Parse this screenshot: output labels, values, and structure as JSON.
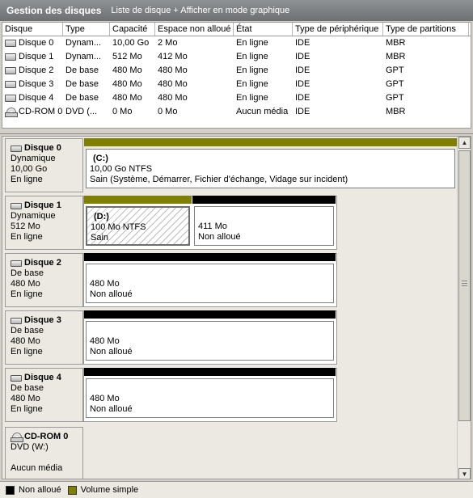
{
  "header": {
    "title": "Gestion des disques",
    "view_label": "Liste de disque + Afficher en mode graphique"
  },
  "list": {
    "columns": [
      "Disque",
      "Type",
      "Capacité",
      "Espace non alloué",
      "État",
      "Type de périphérique",
      "Type de partitions"
    ],
    "rows": [
      {
        "icon": "hard-disk-icon",
        "cells": [
          "Disque 0",
          "Dynam...",
          "10,00 Go",
          "2 Mo",
          "En ligne",
          "IDE",
          "MBR"
        ]
      },
      {
        "icon": "hard-disk-icon",
        "cells": [
          "Disque 1",
          "Dynam...",
          "512 Mo",
          "412 Mo",
          "En ligne",
          "IDE",
          "MBR"
        ]
      },
      {
        "icon": "hard-disk-icon",
        "cells": [
          "Disque 2",
          "De base",
          "480 Mo",
          "480 Mo",
          "En ligne",
          "IDE",
          "GPT"
        ]
      },
      {
        "icon": "hard-disk-icon",
        "cells": [
          "Disque 3",
          "De base",
          "480 Mo",
          "480 Mo",
          "En ligne",
          "IDE",
          "GPT"
        ]
      },
      {
        "icon": "hard-disk-icon",
        "cells": [
          "Disque 4",
          "De base",
          "480 Mo",
          "480 Mo",
          "En ligne",
          "IDE",
          "GPT"
        ]
      },
      {
        "icon": "cdrom-icon",
        "cells": [
          "CD-ROM 0",
          "DVD (...",
          "0 Mo",
          "0 Mo",
          "Aucun média",
          "IDE",
          "MBR"
        ]
      }
    ]
  },
  "graph": {
    "disks": [
      {
        "name": "Disque 0",
        "type": "Dynamique",
        "size": "10,00 Go",
        "status": "En ligne",
        "partitions": [
          {
            "letter": "(C:)",
            "size_fs": "10,00 Go NTFS",
            "status": "Sain (Système, Démarrer, Fichier d'échange, Vidage sur incident)"
          }
        ]
      },
      {
        "name": "Disque 1",
        "type": "Dynamique",
        "size": "512 Mo",
        "status": "En ligne",
        "partitions": [
          {
            "letter": "(D:)",
            "size_fs": "100 Mo NTFS",
            "status": "Sain"
          },
          {
            "size_fs": "411 Mo",
            "status": "Non alloué"
          }
        ]
      },
      {
        "name": "Disque 2",
        "type": "De base",
        "size": "480 Mo",
        "status": "En ligne",
        "partitions": [
          {
            "size_fs": "480 Mo",
            "status": "Non alloué"
          }
        ]
      },
      {
        "name": "Disque 3",
        "type": "De base",
        "size": "480 Mo",
        "status": "En ligne",
        "partitions": [
          {
            "size_fs": "480 Mo",
            "status": "Non alloué"
          }
        ]
      },
      {
        "name": "Disque 4",
        "type": "De base",
        "size": "480 Mo",
        "status": "En ligne",
        "partitions": [
          {
            "size_fs": "480 Mo",
            "status": "Non alloué"
          }
        ]
      }
    ],
    "cdrom": {
      "name": "CD-ROM 0",
      "type": "DVD (W:)",
      "status": "Aucun média"
    }
  },
  "legend": {
    "unallocated": "Non alloué",
    "simple_volume": "Volume simple"
  },
  "colors": {
    "unallocated": "#000000",
    "simple_volume": "#808000",
    "title_bar": "#7f8285"
  }
}
